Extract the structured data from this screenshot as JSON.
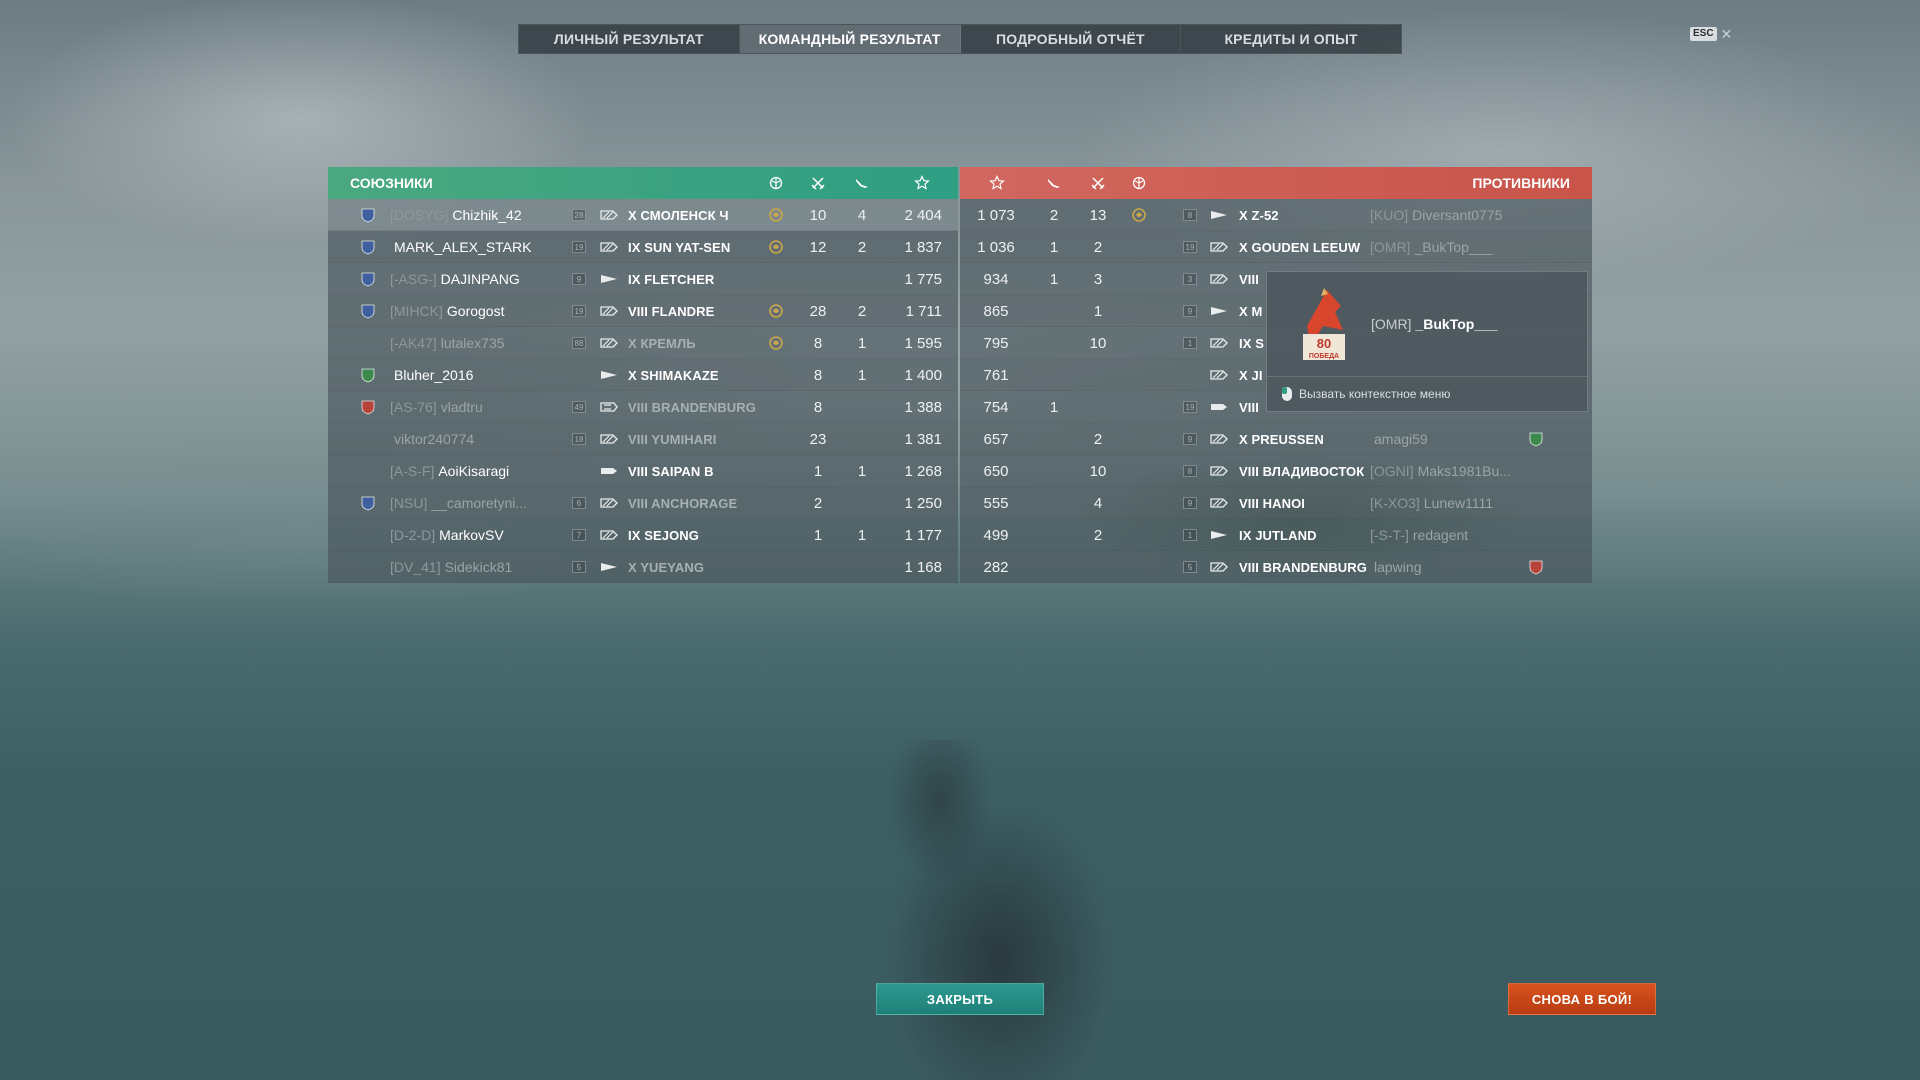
{
  "tabs": [
    {
      "label": "ЛИЧНЫЙ РЕЗУЛЬТАТ",
      "active": false
    },
    {
      "label": "КОМАНДНЫЙ РЕЗУЛЬТАТ",
      "active": true
    },
    {
      "label": "ПОДРОБНЫЙ ОТЧЁТ",
      "active": false
    },
    {
      "label": "КРЕДИТЫ И ОПЫТ",
      "active": false
    }
  ],
  "esc": {
    "key": "ESC",
    "close": "✕"
  },
  "allies": {
    "title": "СОЮЗНИКИ",
    "header_icons": [
      "laurel-wreath-icon",
      "crossed-swords-icon",
      "plane-icon",
      "star-icon"
    ],
    "rows": [
      {
        "clan_badge": "42",
        "tag": "[DOSYG]",
        "name": "Chizhik_42",
        "level": "28",
        "ship_class": "cruiser",
        "ship": "X СМОЛЕНСК Ч",
        "medal": true,
        "frags": "10",
        "planes": "4",
        "score": "2 404",
        "me": true
      },
      {
        "clan_badge": "86",
        "tag": "",
        "name": "MARK_ALEX_STARK",
        "level": "19",
        "ship_class": "cruiser",
        "ship": "IX SUN YAT-SEN",
        "medal": true,
        "frags": "12",
        "planes": "2",
        "score": "1 837"
      },
      {
        "clan_badge": "23",
        "tag": "[-ASG-]",
        "name": "DAJINPANG",
        "level": "9",
        "ship_class": "destroyer",
        "ship": "IX FLETCHER",
        "medal": false,
        "frags": "",
        "planes": "",
        "score": "1 775"
      },
      {
        "clan_badge": "71",
        "tag": "[МIHCK]",
        "name": "Gorogost",
        "level": "19",
        "ship_class": "cruiser",
        "ship": "VIII FLANDRE",
        "medal": true,
        "frags": "28",
        "planes": "2",
        "score": "1 711"
      },
      {
        "clan_badge": "",
        "tag": "[-AK47]",
        "name": "lutalex735",
        "level": "88",
        "ship_class": "cruiser",
        "ship": "X КРЕМЛЬ",
        "medal": true,
        "frags": "8",
        "planes": "1",
        "score": "1 595",
        "dead": true
      },
      {
        "clan_badge": "79",
        "tag": "",
        "name": "Bluher_2016",
        "level": "",
        "ship_class": "destroyer",
        "ship": "X SHIMAKAZE",
        "medal": false,
        "frags": "8",
        "planes": "1",
        "score": "1 400"
      },
      {
        "clan_badge": "45",
        "tag": "[AS-76]",
        "name": "vladtru",
        "level": "49",
        "ship_class": "battleship",
        "ship": "VIII BRANDENBURG",
        "medal": false,
        "frags": "8",
        "planes": "",
        "score": "1 388",
        "dead": true
      },
      {
        "clan_badge": "",
        "tag": "",
        "name": "viktor240774",
        "level": "18",
        "ship_class": "cruiser",
        "ship": "VIII YUMIHARI",
        "medal": false,
        "frags": "23",
        "planes": "",
        "score": "1 381",
        "dead": true
      },
      {
        "clan_badge": "",
        "tag": "[A-S-F]",
        "name": "AoiKisaragi",
        "level": "",
        "ship_class": "carrier",
        "ship": "VIII SAIPAN B",
        "medal": false,
        "frags": "1",
        "planes": "1",
        "score": "1 268"
      },
      {
        "clan_badge": "62",
        "tag": "[NSU]",
        "name": "__camoretyni...",
        "level": "6",
        "ship_class": "cruiser",
        "ship": "VIII ANCHORAGE",
        "medal": false,
        "frags": "2",
        "planes": "",
        "score": "1 250",
        "dead": true
      },
      {
        "clan_badge": "",
        "tag": "[D-2-D]",
        "name": "MarkovSV",
        "level": "7",
        "ship_class": "cruiser",
        "ship": "IX SEJONG",
        "medal": false,
        "frags": "1",
        "planes": "1",
        "score": "1 177"
      },
      {
        "clan_badge": "",
        "tag": "[DV_41]",
        "name": "Sidekick81",
        "level": "5",
        "ship_class": "destroyer",
        "ship": "X YUEYANG",
        "medal": false,
        "frags": "",
        "planes": "",
        "score": "1 168",
        "dead": true
      }
    ]
  },
  "enemies": {
    "title": "ПРОТИВНИКИ",
    "header_icons": [
      "star-icon",
      "plane-icon",
      "crossed-swords-icon",
      "laurel-wreath-icon"
    ],
    "rows": [
      {
        "score": "1 073",
        "planes": "2",
        "frags": "13",
        "medal": true,
        "level": "8",
        "ship_class": "destroyer",
        "ship": "X Z-52",
        "tag": "[KUO]",
        "name": "Diversant0775",
        "badge": ""
      },
      {
        "score": "1 036",
        "planes": "1",
        "frags": "2",
        "medal": false,
        "level": "19",
        "ship_class": "cruiser",
        "ship": "X GOUDEN LEEUW",
        "tag": "[OMR]",
        "name": "_BukTop___",
        "badge": ""
      },
      {
        "score": "934",
        "planes": "1",
        "frags": "3",
        "medal": false,
        "level": "3",
        "ship_class": "cruiser",
        "ship": "VIII",
        "tag": "",
        "name": "",
        "badge": ""
      },
      {
        "score": "865",
        "planes": "",
        "frags": "1",
        "medal": false,
        "level": "9",
        "ship_class": "destroyer",
        "ship": "X M",
        "tag": "",
        "name": "",
        "badge": ""
      },
      {
        "score": "795",
        "planes": "",
        "frags": "10",
        "medal": false,
        "level": "1",
        "ship_class": "cruiser",
        "ship": "IX S",
        "tag": "",
        "name": "",
        "badge": ""
      },
      {
        "score": "761",
        "planes": "",
        "frags": "",
        "medal": false,
        "level": "",
        "ship_class": "cruiser",
        "ship": "X JI",
        "tag": "",
        "name": "",
        "badge": ""
      },
      {
        "score": "754",
        "planes": "1",
        "frags": "",
        "medal": false,
        "level": "19",
        "ship_class": "carrier",
        "ship": "VIII",
        "tag": "",
        "name": "",
        "badge": ""
      },
      {
        "score": "657",
        "planes": "",
        "frags": "2",
        "medal": false,
        "level": "9",
        "ship_class": "cruiser",
        "ship": "X PREUSSEN",
        "tag": "",
        "name": "amagi59",
        "badge": "70"
      },
      {
        "score": "650",
        "planes": "",
        "frags": "10",
        "medal": false,
        "level": "8",
        "ship_class": "cruiser",
        "ship": "VIII ВЛАДИВОСТОК",
        "tag": "[OGNI]",
        "name": "Maks1981Bu...",
        "badge": ""
      },
      {
        "score": "555",
        "planes": "",
        "frags": "4",
        "medal": false,
        "level": "9",
        "ship_class": "cruiser",
        "ship": "VIII HANOI",
        "tag": "[K-XO3]",
        "name": "Lunew1111",
        "badge": ""
      },
      {
        "score": "499",
        "planes": "",
        "frags": "2",
        "medal": false,
        "level": "1",
        "ship_class": "destroyer",
        "ship": "IX JUTLAND",
        "tag": "[-S-T-]",
        "name": "redagent",
        "badge": ""
      },
      {
        "score": "282",
        "planes": "",
        "frags": "",
        "medal": false,
        "level": "5",
        "ship_class": "cruiser",
        "ship": "VIII BRANDENBURG",
        "tag": "",
        "name": "lapwing",
        "badge": "42"
      }
    ]
  },
  "tooltip": {
    "tag": "[OMR]",
    "name": "_BukTop___",
    "emblem_text": "80 ПОБЕДА",
    "hint": "Вызвать контекстное меню"
  },
  "buttons": {
    "close": "ЗАКРЫТЬ",
    "battle": "СНОВА В БОЙ!"
  },
  "colors": {
    "allies": "#2f9e82",
    "enemies": "#c9544a",
    "close": "#1f7f78",
    "battle": "#c8471a",
    "medal": "#c9a64a"
  }
}
